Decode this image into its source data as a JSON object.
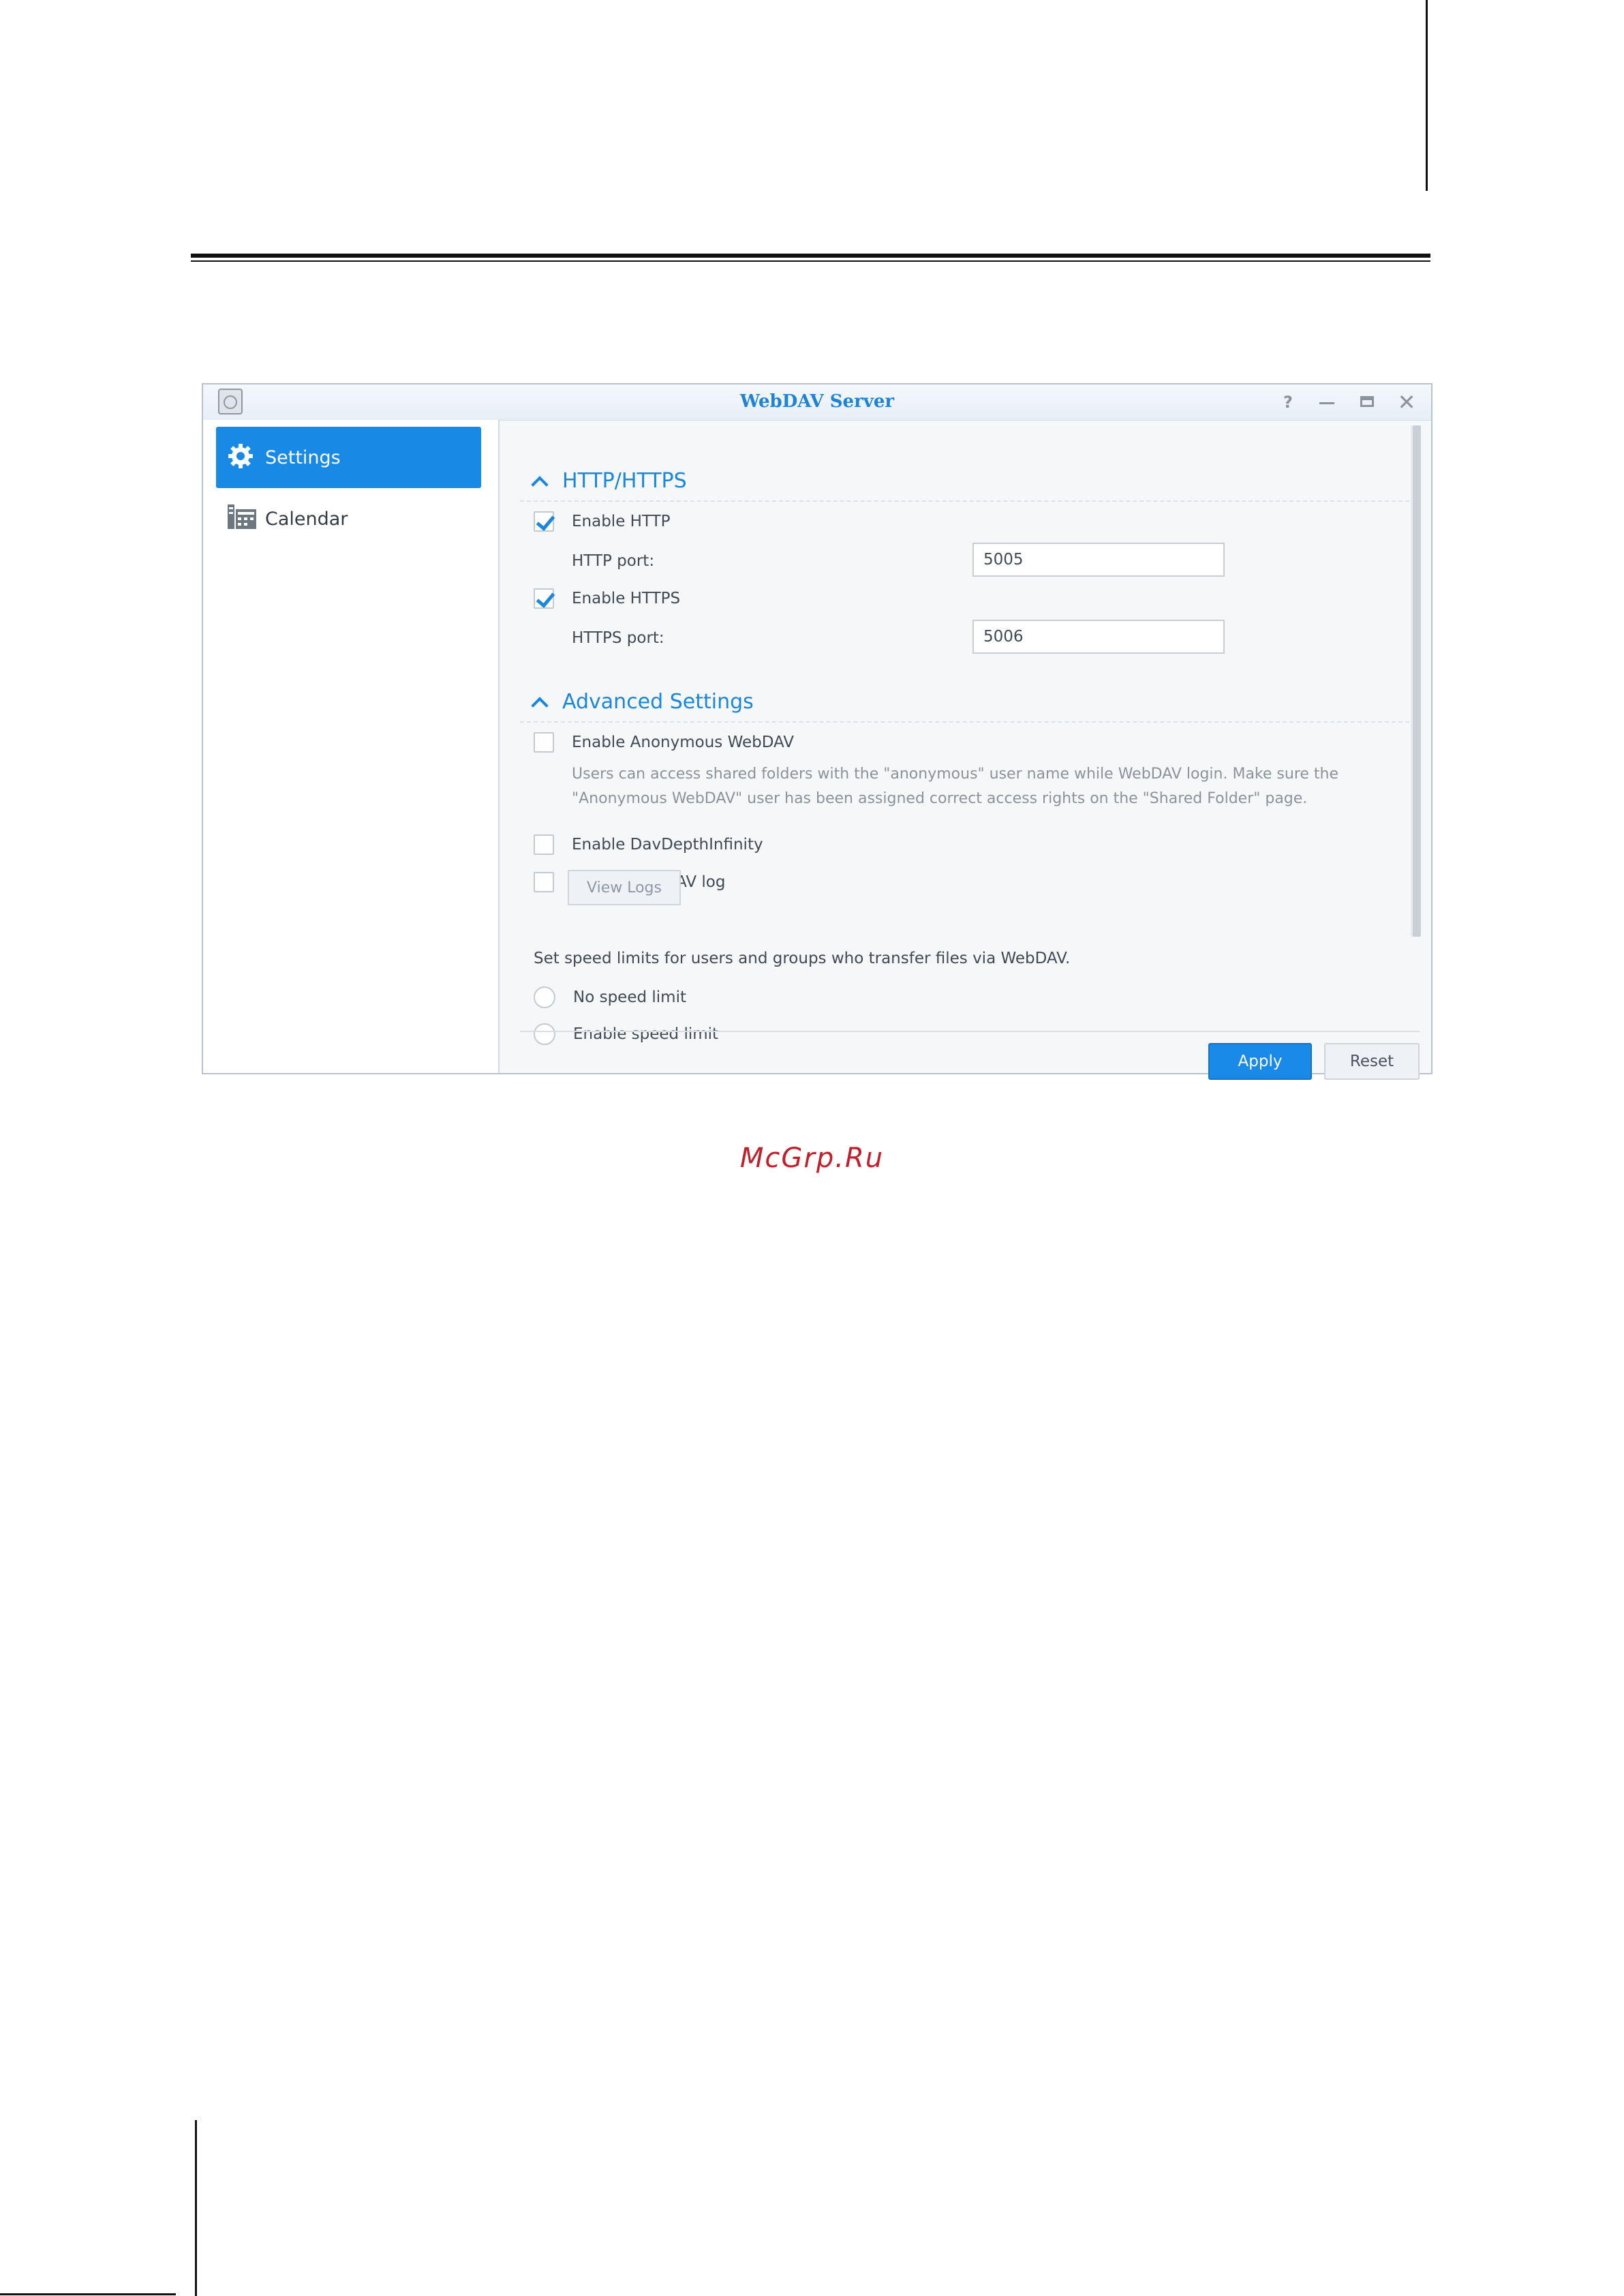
{
  "window": {
    "title": "WebDAV Server",
    "help_glyph": "?",
    "close_glyph": "✕"
  },
  "sidebar": {
    "items": [
      {
        "label": "Settings",
        "icon": "gear-icon",
        "active": true
      },
      {
        "label": "Calendar",
        "icon": "calendar-icon",
        "active": false
      }
    ]
  },
  "http_section": {
    "title": "HTTP/HTTPS",
    "enable_http": {
      "label": "Enable HTTP",
      "checked": true
    },
    "http_port": {
      "label": "HTTP port:",
      "value": "5005"
    },
    "enable_https": {
      "label": "Enable HTTPS",
      "checked": true
    },
    "https_port": {
      "label": "HTTPS port:",
      "value": "5006"
    }
  },
  "advanced_section": {
    "title": "Advanced Settings",
    "anonymous": {
      "label": "Enable Anonymous WebDAV",
      "checked": false
    },
    "anonymous_desc_line1": "Users can access shared folders with the \"anonymous\" user name while WebDAV login. Make sure the",
    "anonymous_desc_line2": "\"Anonymous WebDAV\" user has been assigned correct access rights on the \"Shared Folder\" page.",
    "depth_infinity": {
      "label": "Enable DavDepthInfinity",
      "checked": false
    },
    "webdav_log": {
      "label": "Enable WebDAV log",
      "checked": false
    },
    "view_logs_label": "View Logs",
    "speed_text": "Set speed limits for users and groups who transfer files via WebDAV.",
    "no_speed_limit": "No speed limit",
    "enable_speed_limit": "Enable speed limit"
  },
  "footer": {
    "apply_label": "Apply",
    "reset_label": "Reset"
  },
  "watermark": "McGrp.Ru",
  "colors": {
    "accent": "#1a86dc",
    "active_nav": "#1989e6",
    "watermark": "#c0202b"
  }
}
